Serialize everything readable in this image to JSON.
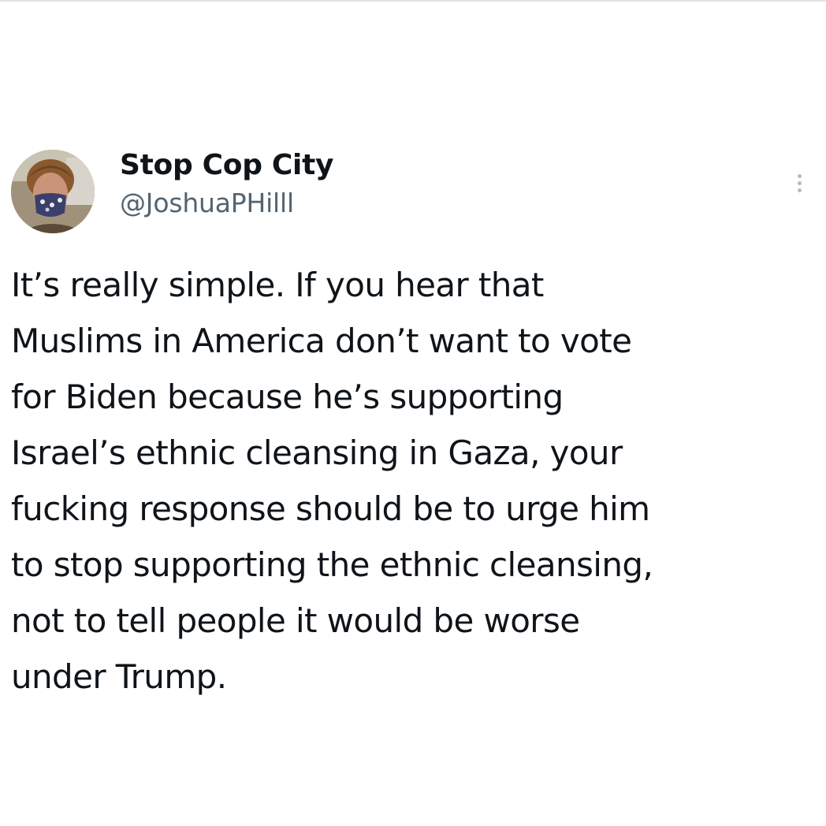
{
  "tweet": {
    "author": {
      "display_name": "Stop Cop City",
      "handle": "@JoshuaPHilll",
      "avatar_icon": "profile-photo"
    },
    "more_icon": "more-vertical-icon",
    "text_lines": [
      "It’s really simple. If you hear that",
      "Muslims in America don’t want to vote",
      "for Biden because he’s supporting",
      "Israel’s ethnic cleansing in Gaza, your",
      "fucking response should be to urge him",
      "to stop supporting the ethnic cleansing,",
      "not to tell people it would be worse",
      "under Trump."
    ]
  },
  "colors": {
    "text": "#0f1419",
    "secondary_text": "#536471",
    "background": "#ffffff"
  }
}
